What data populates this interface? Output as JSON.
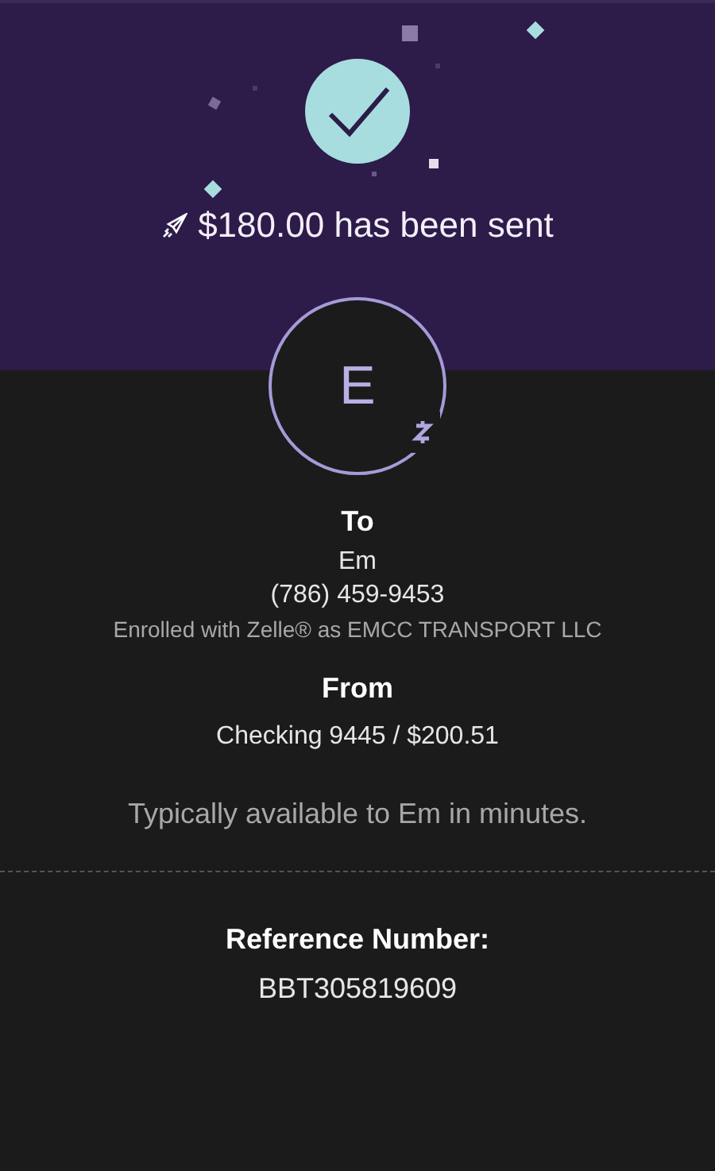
{
  "header": {
    "title": "$180.00 has been sent"
  },
  "recipient": {
    "initial": "E"
  },
  "to": {
    "label": "To",
    "name": "Em",
    "phone": "(786) 459-9453",
    "enrollment": "Enrolled with Zelle® as EMCC TRANSPORT LLC"
  },
  "from": {
    "label": "From",
    "account": "Checking 9445 / $200.51"
  },
  "availability": "Typically available to Em in minutes.",
  "reference": {
    "label": "Reference Number:",
    "number": "BBT305819609"
  }
}
